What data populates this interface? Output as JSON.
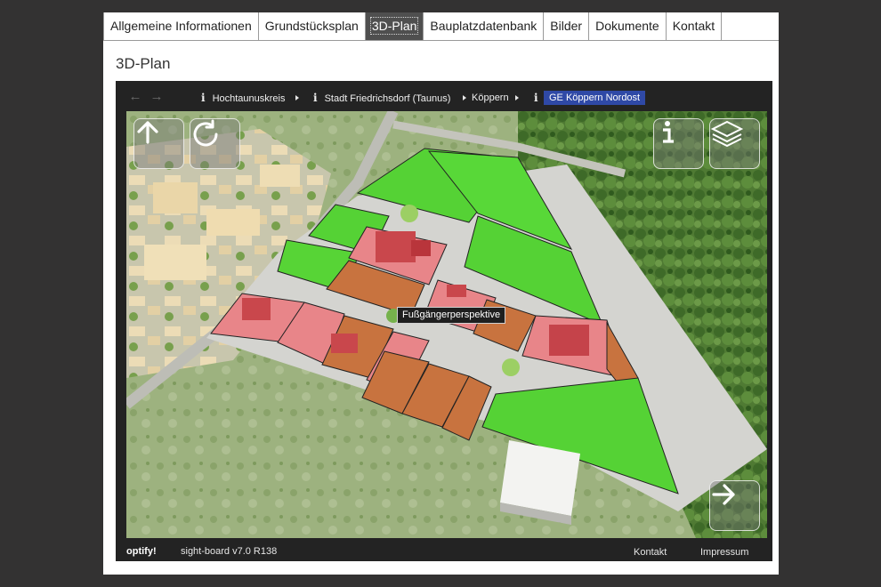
{
  "tabs": [
    {
      "label": "Allgemeine Informationen"
    },
    {
      "label": "Grundstücksplan"
    },
    {
      "label": "3D-Plan"
    },
    {
      "label": "Bauplatzdatenbank"
    },
    {
      "label": "Bilder"
    },
    {
      "label": "Dokumente"
    },
    {
      "label": "Kontakt"
    }
  ],
  "active_tab": "3D-Plan",
  "page_title": "3D-Plan",
  "breadcrumb": {
    "items": [
      {
        "label": "Hochtaunuskreis"
      },
      {
        "label": "Stadt Friedrichsdorf (Taunus)"
      },
      {
        "label": "Köppern"
      },
      {
        "label": "GE Köppern Nordost"
      }
    ],
    "info_glyph": "i"
  },
  "map": {
    "tooltip": "Fußgängerperspektive",
    "buttons": [
      "arrow-up-icon",
      "rotate-icon",
      "info-icon",
      "layers-icon",
      "arrow-right-icon"
    ],
    "colors": {
      "plot_available": "#55d235",
      "plot_reserved": "#c8733f",
      "plot_sold": "#e88589",
      "road": "#c9c9c9"
    }
  },
  "footer": {
    "brand": "optify!",
    "version": "sight-board v7.0 R138",
    "contact": "Kontakt",
    "imprint": "Impressum"
  }
}
